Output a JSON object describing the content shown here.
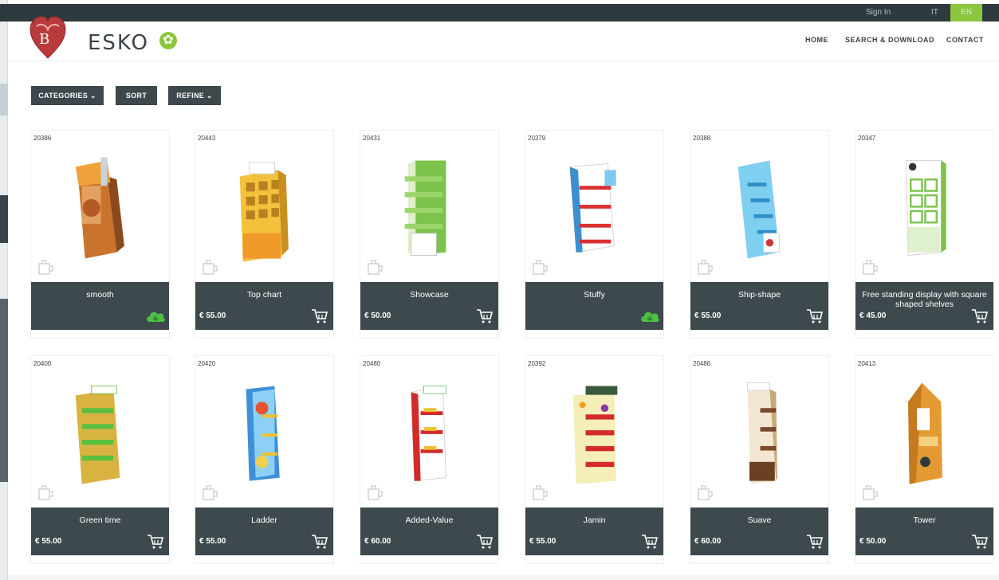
{
  "topbar": {
    "signin": "Sign In",
    "lang_it": "IT",
    "lang_en": "EN"
  },
  "header": {
    "brand": "ESKO",
    "nav": {
      "home": "HOME",
      "search": "SEARCH & DOWNLOAD",
      "contact": "CONTACT"
    }
  },
  "filters": {
    "categories": "CATEGORIES ⌄",
    "sort": "SORT",
    "refine": "REFINE ⌄"
  },
  "colors": {
    "accent_green": "#8cc63f",
    "bar_dark": "#3e494e",
    "topbar": "#2f3a3e"
  },
  "products": [
    {
      "id": "20386",
      "title": "smooth",
      "price": "",
      "icon": "cloud-download-icon",
      "art": "smooth"
    },
    {
      "id": "20443",
      "title": "Top chart",
      "price": "€ 55.00",
      "icon": "cart-icon",
      "art": "topchart"
    },
    {
      "id": "20431",
      "title": "Showcase",
      "price": "€ 50.00",
      "icon": "cart-icon",
      "art": "showcase"
    },
    {
      "id": "20379",
      "title": "Stuffy",
      "price": "",
      "icon": "cloud-download-icon",
      "art": "stuffy"
    },
    {
      "id": "20388",
      "title": "Ship-shape",
      "price": "€ 55.00",
      "icon": "cart-icon",
      "art": "shipshape"
    },
    {
      "id": "20347",
      "title": "Free standing display with square shaped shelves",
      "price": "€ 45.00",
      "icon": "cart-icon",
      "art": "squares"
    },
    {
      "id": "20400",
      "title": "Green time",
      "price": "€ 55.00",
      "icon": "cart-icon",
      "art": "greentime"
    },
    {
      "id": "20420",
      "title": "Ladder",
      "price": "€ 55.00",
      "icon": "cart-icon",
      "art": "ladder"
    },
    {
      "id": "20480",
      "title": "Added-Value",
      "price": "€ 60.00",
      "icon": "cart-icon",
      "art": "addedvalue"
    },
    {
      "id": "20392",
      "title": "Jamin",
      "price": "€ 55.00",
      "icon": "cart-icon",
      "art": "jamin"
    },
    {
      "id": "20486",
      "title": "Suave",
      "price": "€ 60.00",
      "icon": "cart-icon",
      "art": "suave"
    },
    {
      "id": "20413",
      "title": "Tower",
      "price": "€ 50.00",
      "icon": "cart-icon",
      "art": "tower"
    }
  ]
}
